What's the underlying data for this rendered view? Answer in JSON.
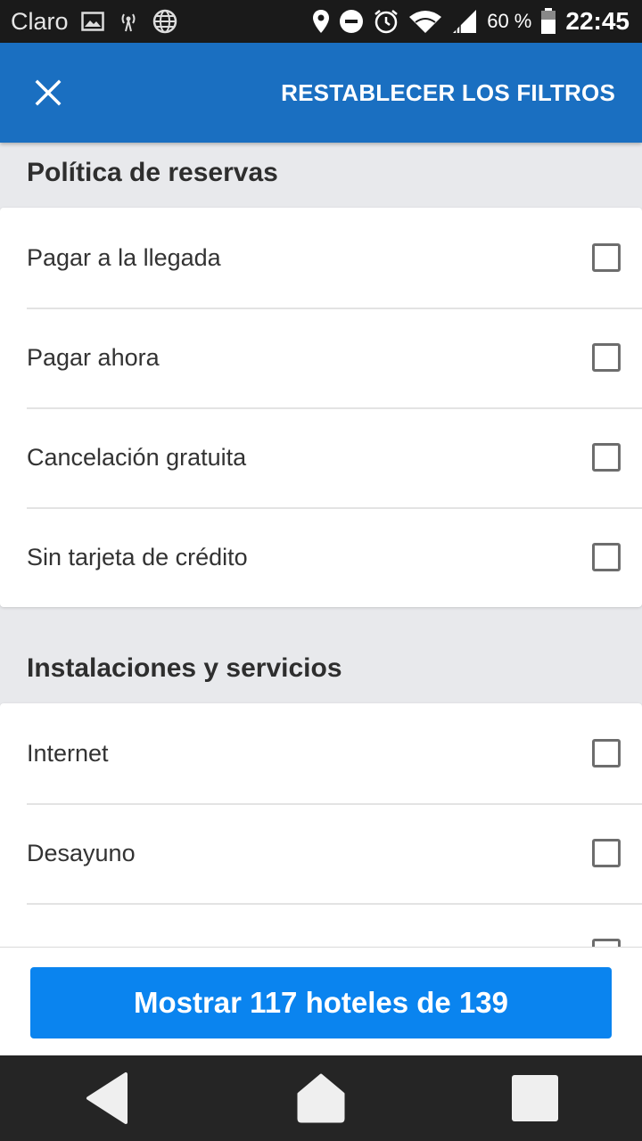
{
  "status_bar": {
    "carrier": "Claro",
    "battery_percent": "60 %",
    "time": "22:45",
    "icons": [
      "image-icon",
      "hotspot-icon",
      "globe-icon",
      "location-icon",
      "do-not-disturb-icon",
      "alarm-icon",
      "wifi-icon",
      "signal-icon",
      "battery-icon"
    ]
  },
  "app_bar": {
    "close_icon": "close-icon",
    "reset_label": "RESTABLECER LOS FILTROS",
    "color": "#1a6fc1"
  },
  "sections": [
    {
      "title": "Política de reservas",
      "options": [
        {
          "label": "Pagar a la llegada",
          "checked": false
        },
        {
          "label": "Pagar ahora",
          "checked": false
        },
        {
          "label": "Cancelación gratuita",
          "checked": false
        },
        {
          "label": "Sin tarjeta de crédito",
          "checked": false
        }
      ]
    },
    {
      "title": "Instalaciones y servicios",
      "options": [
        {
          "label": "Internet",
          "checked": false
        },
        {
          "label": "Desayuno",
          "checked": false
        }
      ]
    }
  ],
  "action": {
    "label": "Mostrar 117 hoteles de 139",
    "color": "#0a84ef"
  },
  "nav_bar": {
    "icons": [
      "back-icon",
      "home-icon",
      "recents-icon"
    ]
  }
}
